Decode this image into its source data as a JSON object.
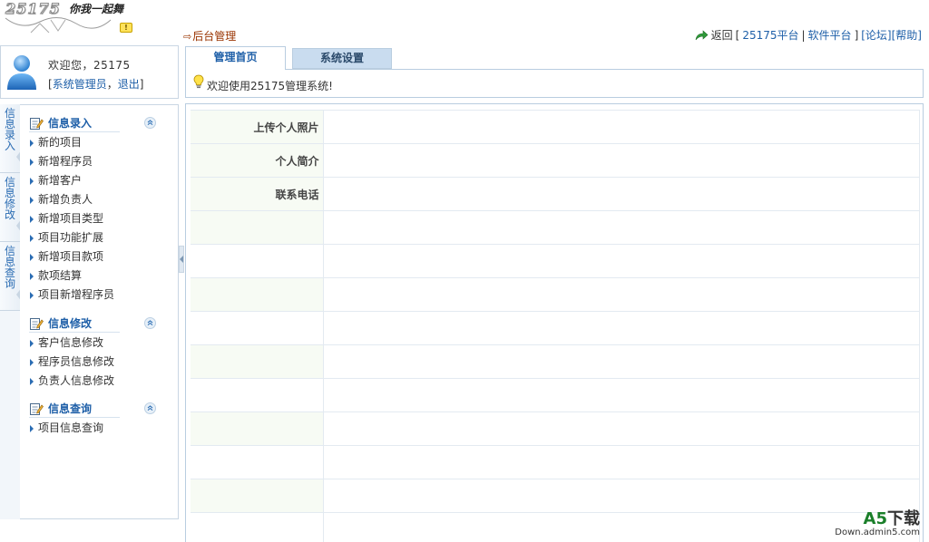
{
  "header": {
    "logo_text": "25175",
    "slogan": "你我一起舞",
    "admin_link": "后台管理",
    "topnav": {
      "return_label": "返回",
      "open_bracket": "[",
      "links": [
        "25175平台",
        "软件平台"
      ],
      "close_bracket": "]",
      "forum": "[论坛]",
      "help": "[帮助]"
    }
  },
  "user": {
    "welcome": "欢迎您，25175",
    "role_link": "系统管理员",
    "logout_link": "退出"
  },
  "side_tabs": [
    "信息录入",
    "信息修改",
    "信息查询"
  ],
  "menu": [
    {
      "title": "信息录入",
      "items": [
        "新的项目",
        "新增程序员",
        "新增客户",
        "新增负责人",
        "新增项目类型",
        "项目功能扩展",
        "新增项目款项",
        "款项结算",
        "项目新增程序员"
      ]
    },
    {
      "title": "信息修改",
      "items": [
        "客户信息修改",
        "程序员信息修改",
        "负责人信息修改"
      ]
    },
    {
      "title": "信息查询",
      "items": [
        "项目信息查询"
      ]
    }
  ],
  "main_tabs": [
    "管理首页",
    "系统设置"
  ],
  "welcome_message": "欢迎使用25175管理系统!",
  "form_rows": [
    {
      "label": "上传个人照片",
      "value": ""
    },
    {
      "label": "个人简介",
      "value": ""
    },
    {
      "label": "联系电话",
      "value": ""
    },
    {
      "label": "",
      "value": ""
    },
    {
      "label": "",
      "value": ""
    },
    {
      "label": "",
      "value": ""
    },
    {
      "label": "",
      "value": ""
    },
    {
      "label": "",
      "value": ""
    },
    {
      "label": "",
      "value": ""
    },
    {
      "label": "",
      "value": ""
    },
    {
      "label": "",
      "value": ""
    },
    {
      "label": "",
      "value": ""
    },
    {
      "label": "",
      "value": ""
    }
  ],
  "watermark": {
    "brand_a5": "A5",
    "brand_rest": "下载",
    "site": "Down.admin5.com"
  },
  "colors": {
    "link_blue": "#1e5fa8",
    "admin_brown": "#993300",
    "border": "#b9cde0",
    "inactive_tab": "#c9dcef"
  }
}
